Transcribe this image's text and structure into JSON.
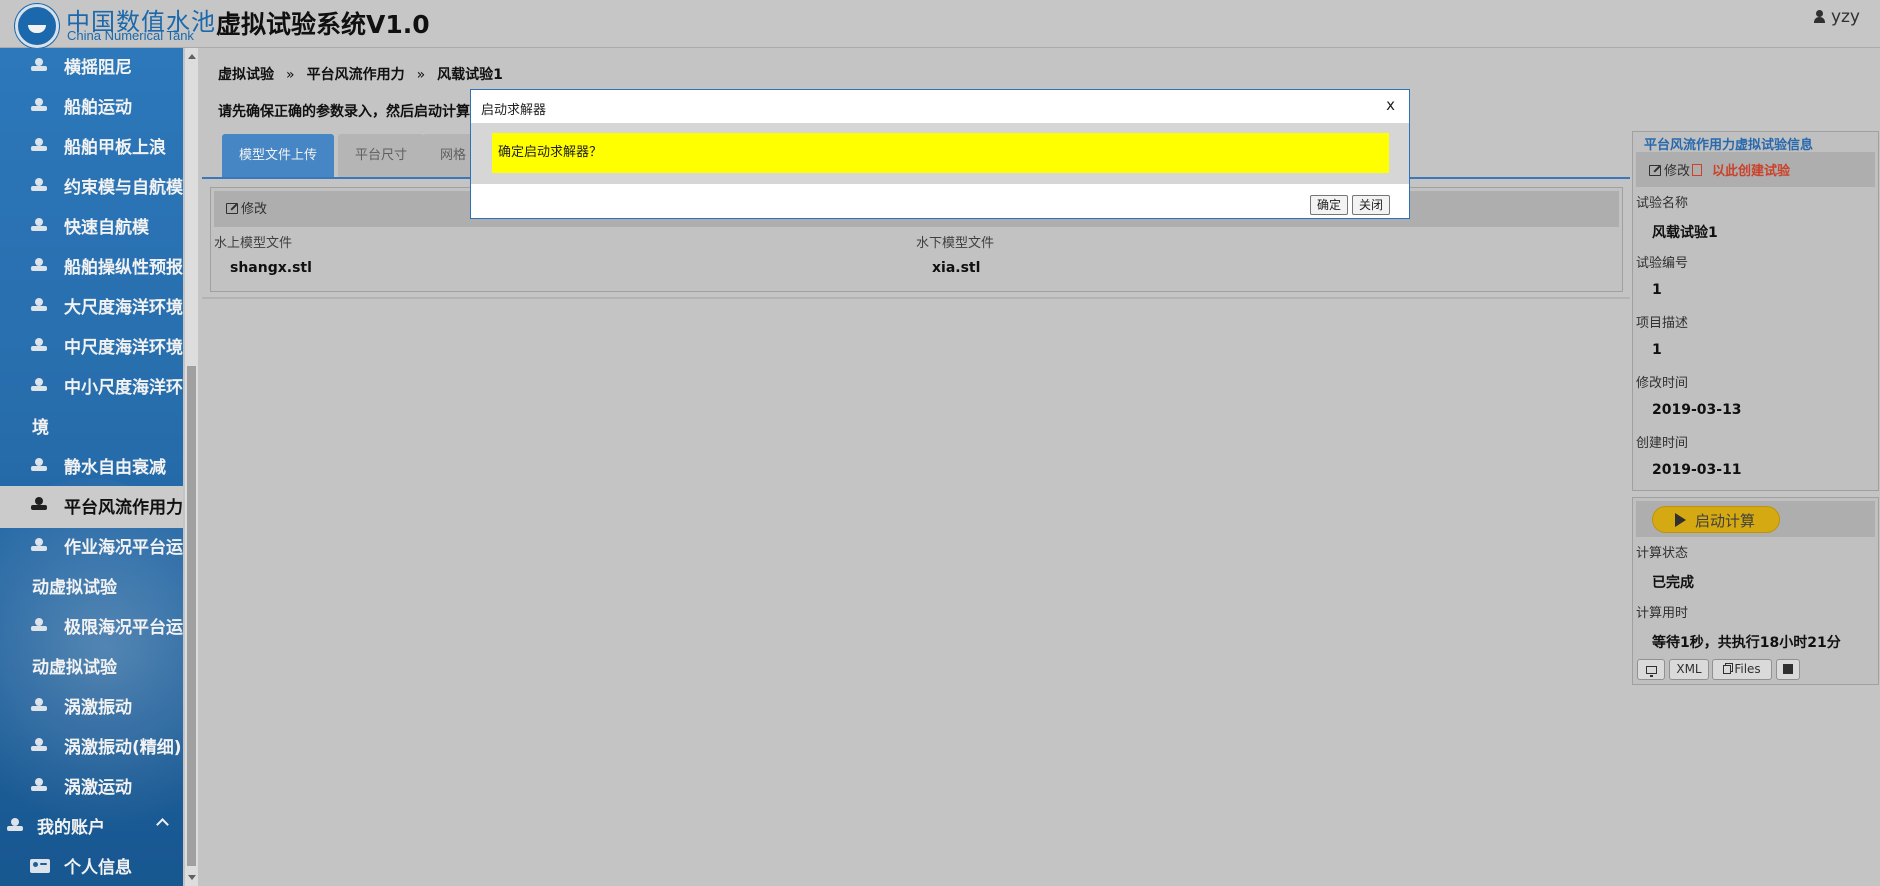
{
  "header": {
    "logo_cn": "中国数值水池",
    "logo_en": "China Numerical Tank",
    "app_title": "虚拟试验系统V1.0",
    "user": "yzy"
  },
  "sidebar": {
    "items": [
      {
        "label": "横摇阻尼"
      },
      {
        "label": "船舶运动"
      },
      {
        "label": "船舶甲板上浪"
      },
      {
        "label": "约束模与自航模"
      },
      {
        "label": "快速自航模"
      },
      {
        "label": "船舶操纵性预报"
      },
      {
        "label": "大尺度海洋环境"
      },
      {
        "label": "中尺度海洋环境"
      },
      {
        "label": "中小尺度海洋环",
        "label2": "境"
      },
      {
        "label": "静水自由衰减"
      },
      {
        "label": "平台风流作用力",
        "active": true
      },
      {
        "label": "作业海况平台运",
        "label2": "动虚拟试验"
      },
      {
        "label": "极限海况平台运",
        "label2": "动虚拟试验"
      },
      {
        "label": "涡激振动"
      },
      {
        "label": "涡激振动(精细)"
      },
      {
        "label": "涡激运动"
      }
    ],
    "account": "我的账户",
    "profile": "个人信息"
  },
  "breadcrumb": {
    "items": [
      "虚拟试验",
      "平台风流作用力",
      "风载试验1"
    ],
    "separator": "»"
  },
  "notice": "请先确保正确的参数录入，然后启动计算",
  "tabs": [
    "模型文件上传",
    "平台尺寸",
    "网格"
  ],
  "upload": {
    "edit_label": "修改",
    "above_label": "水上模型文件",
    "above_value": "shangx.stl",
    "below_label": "水下模型文件",
    "below_value": "xia.stl"
  },
  "info": {
    "title": "平台风流作用力虚拟试验信息",
    "edit_label": "修改",
    "copy_label": "以此创建试验",
    "fields": [
      {
        "label": "试验名称",
        "value": "风载试验1"
      },
      {
        "label": "试验编号",
        "value": "1"
      },
      {
        "label": "项目描述",
        "value": "1"
      },
      {
        "label": "修改时间",
        "value": "2019-03-13"
      },
      {
        "label": "创建时间",
        "value": "2019-03-11"
      }
    ]
  },
  "calc": {
    "start_label": "启动计算",
    "status_label": "计算状态",
    "status_value": "已完成",
    "time_label": "计算用时",
    "time_value": "等待1秒，共执行18小时21分",
    "buttons": {
      "xml": "XML",
      "files": "Files"
    }
  },
  "dialog": {
    "title": "启动求解器",
    "close": "x",
    "message": "确定启动求解器？",
    "ok": "确定",
    "cancel": "关闭"
  },
  "colors": {
    "sidebar": "#2a73b6",
    "accent": "#4a8ed0",
    "dialog_highlight": "#ffff00",
    "start_button": "#e0b312",
    "copy_link": "#d6452c"
  }
}
